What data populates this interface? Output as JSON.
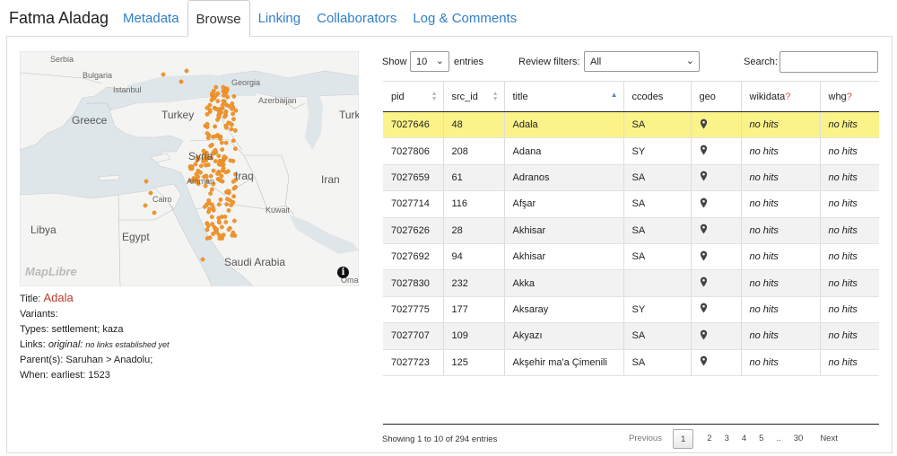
{
  "header": {
    "owner": "Fatma Aladag",
    "tabs": [
      {
        "label": "Metadata"
      },
      {
        "label": "Browse"
      },
      {
        "label": "Linking"
      },
      {
        "label": "Collaborators"
      },
      {
        "label": "Log & Comments"
      }
    ],
    "active_tab": "Browse"
  },
  "map": {
    "labels": {
      "serbia": "Serbia",
      "bulgaria": "Bulgaria",
      "istanbul": "Istanbul",
      "georgia": "Georgia",
      "azerbaijan": "Azerbaijan",
      "greece": "Greece",
      "turkey": "Turkey",
      "turk": "Turk",
      "syria": "Syria",
      "amman": "Amman",
      "cairo": "Cairo",
      "iraq": "Iraq",
      "iran": "Iran",
      "kuwait": "Kuwait",
      "libya": "Libya",
      "egypt": "Egypt",
      "saudi": "Saudi Arabia",
      "oma": "Oma"
    },
    "attribution_logo": "MapLibre",
    "info_icon": "info-icon",
    "point_color": "#f0962e"
  },
  "details": {
    "title_label": "Title:",
    "title_value": "Adala",
    "variants_label": "Variants:",
    "types": "Types: settlement; kaza",
    "links_label": "Links:",
    "links_original": "original:",
    "links_note": "no links established yet",
    "parents": "Parent(s): Saruhan > Anadolu;",
    "when": "When: earliest: 1523"
  },
  "controls": {
    "show_label": "Show",
    "page_size": "10",
    "entries_label": "entries",
    "review_label": "Review filters:",
    "review_value": "All",
    "search_label": "Search:",
    "search_value": ""
  },
  "table": {
    "columns": [
      "pid",
      "src_id",
      "title",
      "ccodes",
      "geo",
      "wikidata",
      "whg"
    ],
    "column_hint": "?",
    "rows": [
      {
        "pid": "7027646",
        "src_id": "48",
        "title": "Adala",
        "ccodes": "SA",
        "wikidata": "no hits",
        "whg": "no hits"
      },
      {
        "pid": "7027806",
        "src_id": "208",
        "title": "Adana",
        "ccodes": "SY",
        "wikidata": "no hits",
        "whg": "no hits"
      },
      {
        "pid": "7027659",
        "src_id": "61",
        "title": "Adranos",
        "ccodes": "SA",
        "wikidata": "no hits",
        "whg": "no hits"
      },
      {
        "pid": "7027714",
        "src_id": "116",
        "title": "Afşar",
        "ccodes": "SA",
        "wikidata": "no hits",
        "whg": "no hits"
      },
      {
        "pid": "7027626",
        "src_id": "28",
        "title": "Akhisar",
        "ccodes": "SA",
        "wikidata": "no hits",
        "whg": "no hits"
      },
      {
        "pid": "7027692",
        "src_id": "94",
        "title": "Akhisar",
        "ccodes": "SA",
        "wikidata": "no hits",
        "whg": "no hits"
      },
      {
        "pid": "7027830",
        "src_id": "232",
        "title": "Akka",
        "ccodes": "",
        "wikidata": "no hits",
        "whg": "no hits"
      },
      {
        "pid": "7027775",
        "src_id": "177",
        "title": "Aksaray",
        "ccodes": "SY",
        "wikidata": "no hits",
        "whg": "no hits"
      },
      {
        "pid": "7027707",
        "src_id": "109",
        "title": "Akyazı",
        "ccodes": "SA",
        "wikidata": "no hits",
        "whg": "no hits"
      },
      {
        "pid": "7027723",
        "src_id": "125",
        "title": "Akşehir ma'a Çimenili",
        "ccodes": "SA",
        "wikidata": "no hits",
        "whg": "no hits"
      }
    ],
    "selected_row": 0,
    "geo_icon": "map-pin-icon"
  },
  "footer": {
    "info": "Showing 1 to 10 of 294 entries",
    "previous": "Previous",
    "pages": [
      "1",
      "2",
      "3",
      "4",
      "5",
      "..",
      "30"
    ],
    "current_page": "1",
    "next": "Next"
  }
}
